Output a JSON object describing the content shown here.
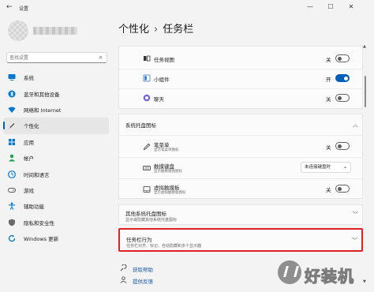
{
  "window": {
    "title": "设置",
    "back_glyph": "←",
    "minimize_glyph": "—",
    "maximize_glyph": "☐",
    "close_glyph": "✕"
  },
  "search": {
    "placeholder": "查找设置",
    "icon": "search-icon"
  },
  "sidebar": {
    "items": [
      {
        "label": "系统",
        "icon": "monitor-icon",
        "color": "#0078d4"
      },
      {
        "label": "蓝牙和其他设备",
        "icon": "bluetooth-icon",
        "color": "#0078d4"
      },
      {
        "label": "网络和 Internet",
        "icon": "wifi-icon",
        "color": "#0078d4"
      },
      {
        "label": "个性化",
        "icon": "pen-icon",
        "color": "#555555",
        "active": true
      },
      {
        "label": "应用",
        "icon": "apps-icon",
        "color": "#0078d4"
      },
      {
        "label": "帐户",
        "icon": "person-icon",
        "color": "#1aa34a"
      },
      {
        "label": "时间和语言",
        "icon": "globe-clock-icon",
        "color": "#0078d4"
      },
      {
        "label": "游戏",
        "icon": "gamepad-icon",
        "color": "#555555"
      },
      {
        "label": "辅助功能",
        "icon": "accessibility-icon",
        "color": "#0078d4"
      },
      {
        "label": "隐私和安全性",
        "icon": "shield-icon",
        "color": "#555555"
      },
      {
        "label": "Windows 更新",
        "icon": "refresh-icon",
        "color": "#0078d4"
      }
    ]
  },
  "header": {
    "parent": "个性化",
    "separator": "›",
    "current": "任务栏"
  },
  "taskbar_items": [
    {
      "label": "任务视图",
      "state": "关",
      "on": false,
      "icon": "task-view-icon"
    },
    {
      "label": "小组件",
      "state": "开",
      "on": true,
      "icon": "widgets-icon"
    },
    {
      "label": "聊天",
      "state": "关",
      "on": false,
      "icon": "chat-icon"
    }
  ],
  "tray_icons": {
    "title": "系统托盘图标",
    "items": [
      {
        "label": "笔菜单",
        "desc": "显示笔菜单图标",
        "state": "关",
        "on": false,
        "icon": "pen-menu-icon"
      },
      {
        "label": "触摸键盘",
        "desc": "显示触摸键盘图标",
        "dropdown": "未连接键盘时",
        "icon": "keyboard-icon"
      },
      {
        "label": "虚拟触摸板",
        "desc": "显示虚拟触摸板图标",
        "state": "关",
        "on": false,
        "icon": "touchpad-icon"
      }
    ]
  },
  "other_tray": {
    "title": "其他系统托盘图标",
    "subtitle": "显示或隐藏其他系统托盘图标"
  },
  "behaviors": {
    "title": "任务栏行为",
    "subtitle": "任务栏对齐、标记、自动隐藏和多个显示器"
  },
  "links": [
    {
      "label": "获取帮助",
      "icon": "help-icon"
    },
    {
      "label": "提供反馈",
      "icon": "feedback-icon"
    }
  ],
  "watermark": {
    "text": "好装机"
  },
  "colors": {
    "accent": "#005fb8",
    "highlight_border": "#e0201f"
  }
}
